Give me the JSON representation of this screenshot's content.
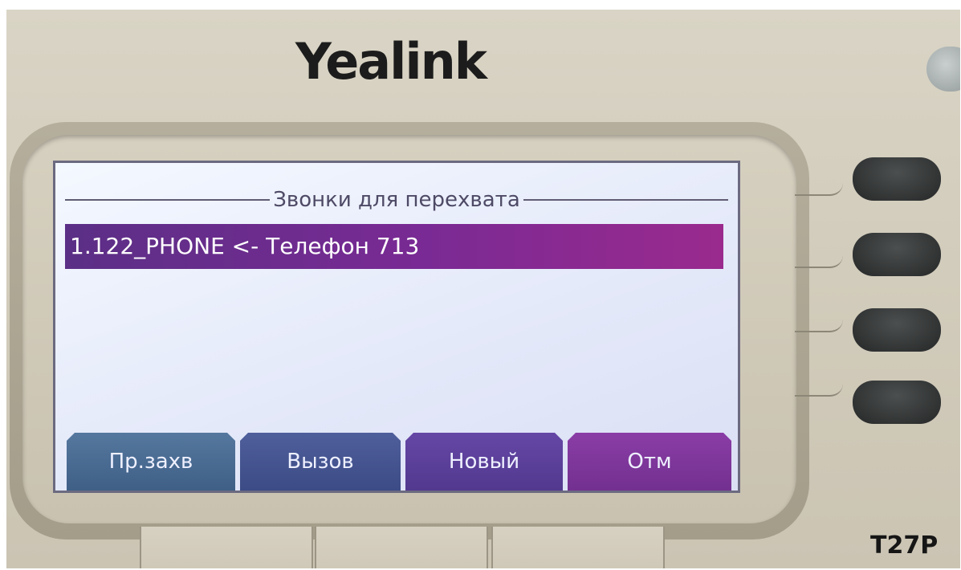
{
  "device": {
    "brand": "Yealink",
    "model": "T27P"
  },
  "screen": {
    "title": "Звонки для перехвата",
    "calls": [
      {
        "label": "1.122_PHONE <- Телефон 713",
        "selected": true
      }
    ],
    "softkeys": [
      {
        "label": "Пр.захв"
      },
      {
        "label": "Вызов"
      },
      {
        "label": "Новый"
      },
      {
        "label": "Отм"
      }
    ]
  },
  "colors": {
    "selection": "#7a2a94",
    "lcd_background": "#e3e8f9",
    "softkey_1": "#4a6c94",
    "softkey_2": "#45558f",
    "softkey_3": "#5c409a",
    "softkey_4": "#7f369b"
  }
}
